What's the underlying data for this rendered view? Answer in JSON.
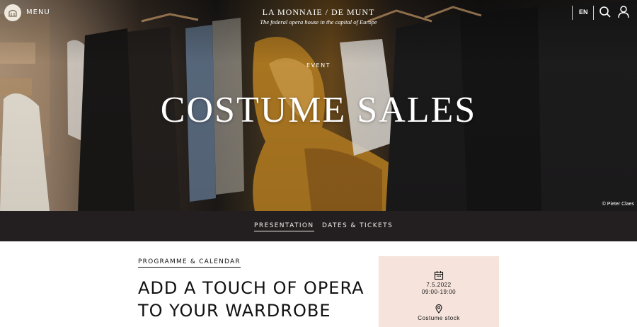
{
  "header": {
    "menu_label": "MENU",
    "brand_title": "LA MONNAIE / DE MUNT",
    "brand_subtitle": "The federal opera house in the capital of Europe",
    "language": "EN",
    "icons": [
      "logo-icon",
      "search-icon",
      "user-icon"
    ]
  },
  "hero": {
    "kicker": "EVENT",
    "title": "COSTUME SALES",
    "credit": "© Pieter Claes"
  },
  "tabs": [
    {
      "label": "PRESENTATION",
      "active": true
    },
    {
      "label": "DATES & TICKETS",
      "active": false
    }
  ],
  "content": {
    "breadcrumb": "PROGRAMME & CALENDAR",
    "headline_line1": "ADD A TOUCH OF OPERA",
    "headline_line2": "TO YOUR WARDROBE"
  },
  "info_card": {
    "date": "7.5.2022",
    "time": "09:00-19:00",
    "location": "Costume stock",
    "icons": [
      "calendar-icon",
      "location-pin-icon"
    ]
  },
  "colors": {
    "tab_bar_bg": "#231f20",
    "card_bg": "#f5e3dc",
    "text": "#111111"
  }
}
